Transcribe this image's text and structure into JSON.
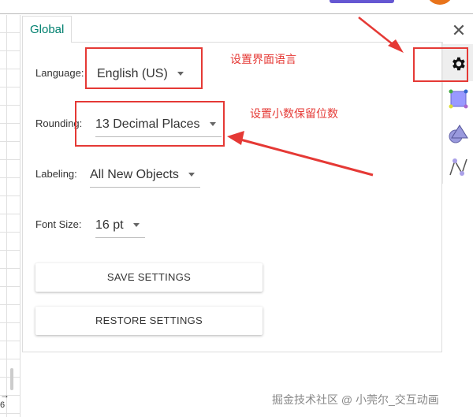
{
  "tab": {
    "label": "Global"
  },
  "settings": {
    "language": {
      "label": "Language:",
      "value": "English (US)"
    },
    "rounding": {
      "label": "Rounding:",
      "value": "13 Decimal Places"
    },
    "labeling": {
      "label": "Labeling:",
      "value": "All New Objects"
    },
    "font_size": {
      "label": "Font Size:",
      "value": "16 pt"
    }
  },
  "buttons": {
    "save": "SAVE SETTINGS",
    "restore": "RESTORE SETTINGS"
  },
  "annotations": {
    "language_note": "设置界面语言",
    "rounding_note": "设置小数保留位数"
  },
  "graphics": {
    "axis_tick": "6"
  },
  "watermark": "掘金技术社区 @ 小莞尔_交互动画",
  "colors": {
    "accent": "#00806f",
    "annotation": "#e53935"
  }
}
